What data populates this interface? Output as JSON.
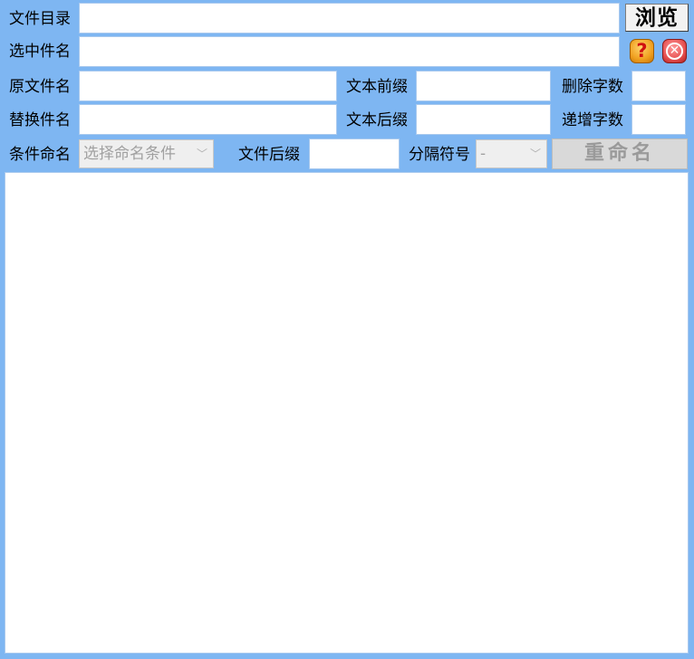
{
  "row1": {
    "dir_label": "文件目录",
    "dir_value": "",
    "browse_label": "浏览"
  },
  "row2": {
    "selected_label": "选中件名",
    "selected_value": "",
    "help_icon": "help-icon",
    "close_icon": "close-icon",
    "help_glyph": "?",
    "close_glyph": "✕"
  },
  "row3": {
    "orig_label": "原文件名",
    "orig_value": "",
    "prefix_label": "文本前缀",
    "prefix_value": "",
    "delete_label": "删除字数",
    "delete_value": ""
  },
  "row4": {
    "replace_label": "替换件名",
    "replace_value": "",
    "suffix_label": "文本后缀",
    "suffix_value": "",
    "increment_label": "递增字数",
    "increment_value": ""
  },
  "row5": {
    "cond_label": "条件命名",
    "cond_selected": "选择命名条件",
    "ext_label": "文件后缀",
    "ext_value": "",
    "sep_label": "分隔符号",
    "sep_selected": "-",
    "rename_label": "重命名"
  },
  "colors": {
    "background": "#7eb6f2",
    "field": "#ffffff",
    "disabled": "#d9d9d9"
  }
}
